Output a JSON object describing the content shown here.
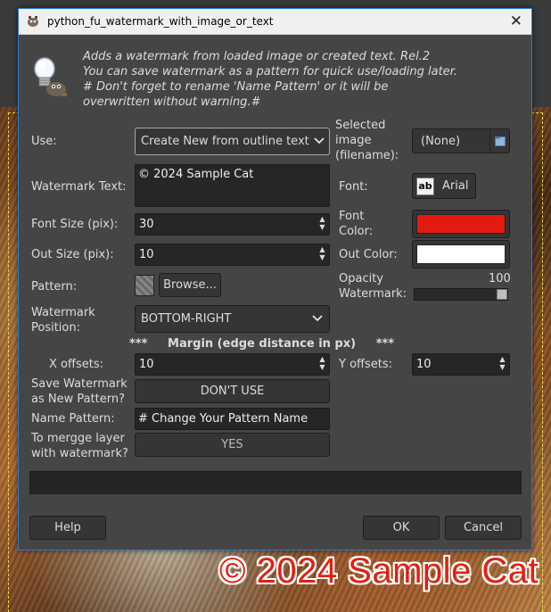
{
  "window": {
    "title": "python_fu_watermark_with_image_or_text"
  },
  "description": [
    "Adds a watermark from loaded image or created text. Rel.2",
    "You can save watermark as a pattern for quick use/loading later.",
    "# Don't forget to rename 'Name Pattern' or it will be",
    "overwritten without warning.#"
  ],
  "form": {
    "use_label": "Use:",
    "use_value": "Create New from outline text",
    "selected_image_label": [
      "Selected",
      "image",
      "(filename):"
    ],
    "selected_image_value": "(None)",
    "watermark_text_label": "Watermark Text:",
    "watermark_text_value": "© 2024 Sample Cat",
    "font_label": "Font:",
    "font_value": "Arial",
    "font_icon_text": "ab",
    "font_size_label": "Font Size (pix):",
    "font_size_value": "30",
    "font_color_label": [
      "Font",
      "Color:"
    ],
    "font_color": "#e11b10",
    "out_size_label": "Out Size (pix):",
    "out_size_value": "10",
    "out_color_label": "Out Color:",
    "out_color": "#ffffff",
    "pattern_label": "Pattern:",
    "pattern_button": "Browse...",
    "opacity_label": [
      "Opacity",
      "Watermark:"
    ],
    "opacity_value": "100",
    "opacity_fraction": 1.0,
    "position_label": [
      "Watermark",
      "Position:"
    ],
    "position_value": "BOTTOM-RIGHT",
    "margin_heading": "***     Margin (edge distance in px)     ***",
    "x_offsets_label": "X offsets:",
    "x_offsets_value": "10",
    "y_offsets_label": "Y offsets:",
    "y_offsets_value": "10",
    "save_pattern_label": [
      "Save Watermark",
      "as New Pattern?"
    ],
    "save_pattern_value": "DON'T USE",
    "name_pattern_label": "Name Pattern:",
    "name_pattern_value": "# Change Your Pattern Name",
    "merge_label": [
      "To mergge layer",
      "with watermark?"
    ],
    "merge_value": "YES"
  },
  "buttons": {
    "help": "Help",
    "ok": "OK",
    "cancel": "Cancel"
  },
  "background": {
    "watermark_text": "© 2024 Sample Cat"
  }
}
